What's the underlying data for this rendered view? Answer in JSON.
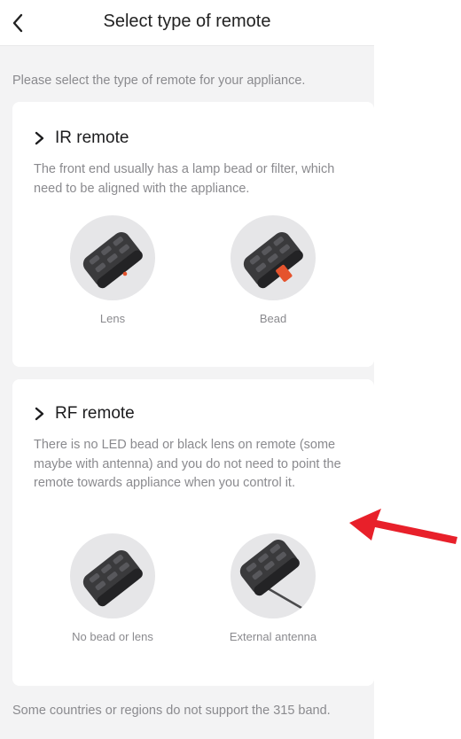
{
  "header": {
    "title": "Select type of remote"
  },
  "intro": "Please select the type of remote for your appliance.",
  "ir": {
    "title": "IR remote",
    "description": "The front end usually has a lamp bead or filter, which need to be aligned with the appliance.",
    "options": [
      {
        "label": "Lens",
        "icon": "remote-lens-icon"
      },
      {
        "label": "Bead",
        "icon": "remote-bead-icon"
      }
    ]
  },
  "rf": {
    "title": "RF remote",
    "description": "There is no LED bead or black lens on remote (some maybe with antenna) and you do not need to point the remote towards appliance when you control it.",
    "options": [
      {
        "label": "No bead or lens",
        "icon": "remote-plain-icon"
      },
      {
        "label": "External antenna",
        "icon": "remote-antenna-icon"
      }
    ]
  },
  "footer_note": "Some countries or regions do not support the 315 band.",
  "colors": {
    "background": "#f3f3f4",
    "card": "#ffffff",
    "accent_red": "#e8202a",
    "bead_orange": "#e5532d"
  }
}
